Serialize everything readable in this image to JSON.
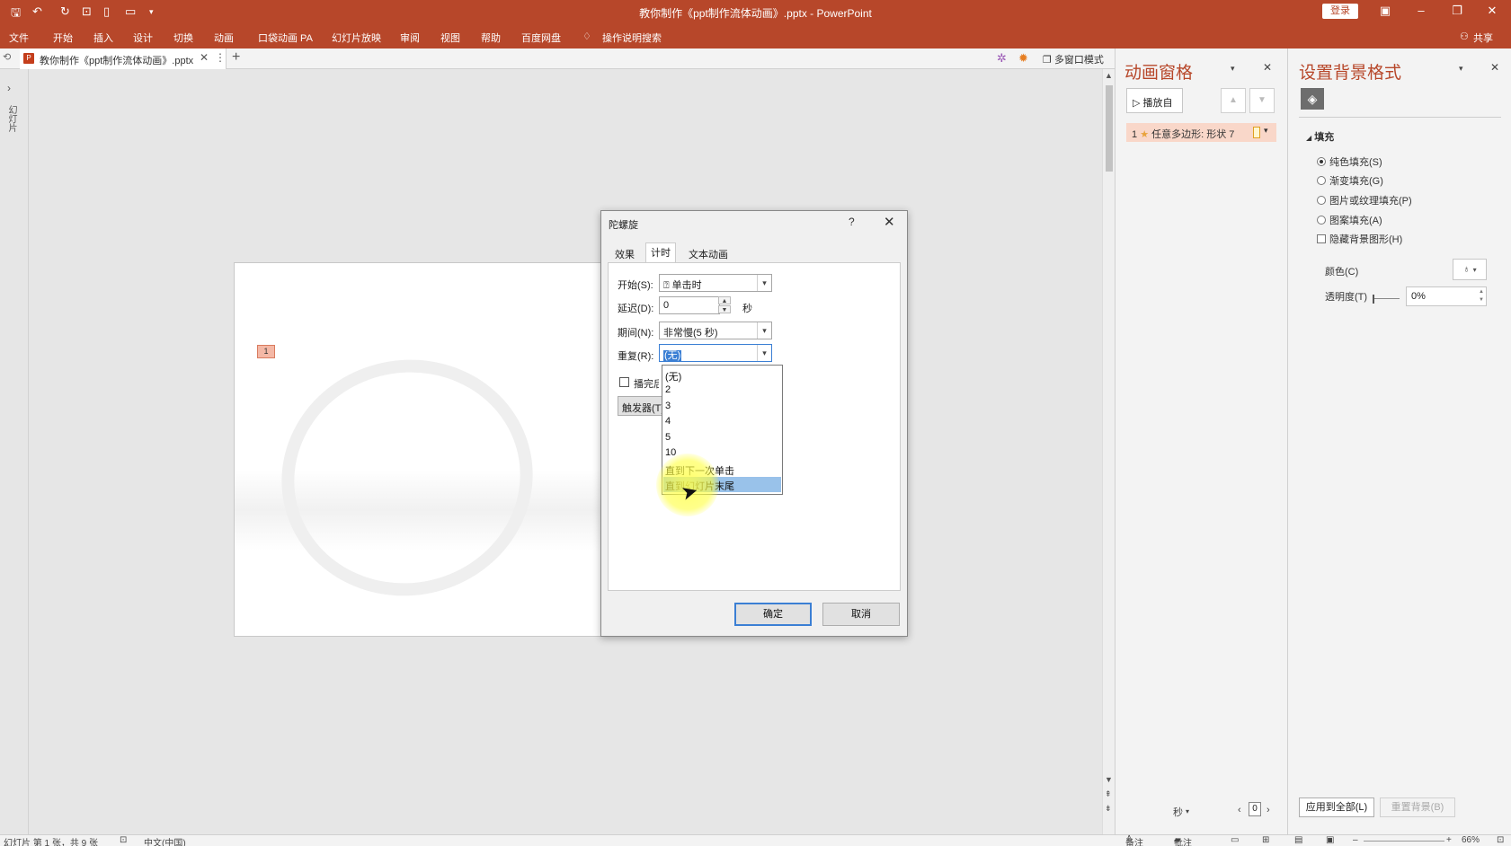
{
  "window": {
    "title": "教你制作《ppt制作流体动画》.pptx  -  PowerPoint",
    "login_label": "登录",
    "share_label": "共享"
  },
  "ribbon": {
    "tabs": [
      "文件",
      "开始",
      "插入",
      "设计",
      "切换",
      "动画",
      "口袋动画 PA",
      "幻灯片放映",
      "审阅",
      "视图",
      "帮助",
      "百度网盘"
    ],
    "search_label": "操作说明搜索"
  },
  "doc_tab": {
    "name": "教你制作《ppt制作流体动画》.pptx",
    "multiwindow_label": "多窗口模式"
  },
  "left_panel": {
    "label": "幻灯片"
  },
  "slide": {
    "anim_tag": "1"
  },
  "dialog": {
    "title": "陀螺旋",
    "help": "?",
    "tabs": [
      "效果",
      "计时",
      "文本动画"
    ],
    "active_tab": "计时",
    "start_label": "开始(S):",
    "start_value": "单击时",
    "delay_label": "延迟(D):",
    "delay_value": "0",
    "delay_unit": "秒",
    "duration_label": "期间(N):",
    "duration_value": "非常慢(5 秒)",
    "repeat_label": "重复(R):",
    "repeat_value": "(无)",
    "rewind_label": "播完后快退(W)",
    "trigger_label": "触发器(T)",
    "repeat_options": [
      "(无)",
      "2",
      "3",
      "4",
      "5",
      "10",
      "直到下一次单击",
      "直到幻灯片末尾"
    ],
    "highlighted_option": 7,
    "ok_label": "确定",
    "cancel_label": "取消"
  },
  "animation_pane": {
    "title": "动画窗格",
    "play_label": "播放自",
    "item_index": "1",
    "item_name": "任意多边形: 形状 7",
    "seconds_label": "秒",
    "page_value": "0"
  },
  "format_pane": {
    "title": "设置背景格式",
    "fill_header": "填充",
    "options": [
      {
        "label": "纯色填充(S)",
        "type": "radio",
        "checked": true
      },
      {
        "label": "渐变填充(G)",
        "type": "radio",
        "checked": false
      },
      {
        "label": "图片或纹理填充(P)",
        "type": "radio",
        "checked": false
      },
      {
        "label": "图案填充(A)",
        "type": "radio",
        "checked": false
      },
      {
        "label": "隐藏背景图形(H)",
        "type": "checkbox",
        "checked": false
      }
    ],
    "color_label": "颜色(C)",
    "transparency_label": "透明度(T)",
    "transparency_value": "0%",
    "apply_all_label": "应用到全部(L)",
    "reset_label": "重置背景(B)"
  },
  "status_bar": {
    "slide_info": "幻灯片 第 1 张，共 9 张",
    "language": "中文(中国)",
    "notes_label": "备注",
    "comments_label": "批注",
    "zoom": "66%"
  },
  "colors": {
    "accent": "#b7472a",
    "selection": "#99c2ea"
  }
}
